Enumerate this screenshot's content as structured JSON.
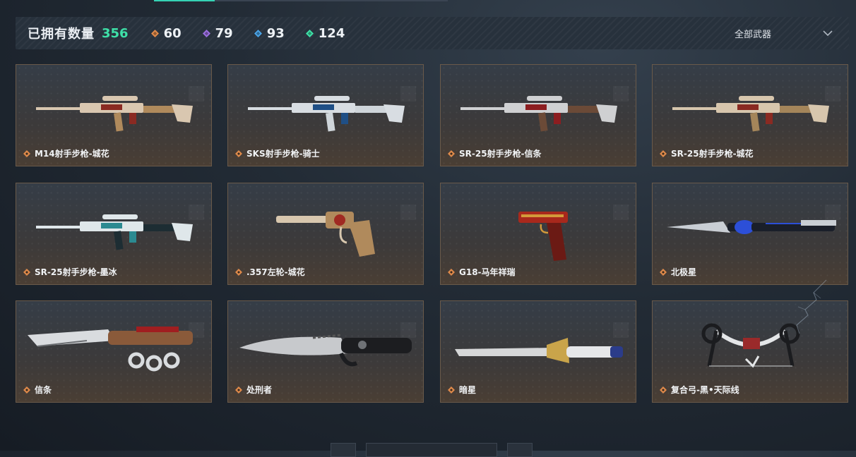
{
  "header": {
    "owned_label": "已拥有数量",
    "owned_count": "356",
    "rarities": [
      {
        "icon": "orange-diamond-icon",
        "color": "#e08a4a",
        "count": "60"
      },
      {
        "icon": "purple-diamond-icon",
        "color": "#9a6ee0",
        "count": "79"
      },
      {
        "icon": "blue-diamond-icon",
        "color": "#4aa3e6",
        "count": "93"
      },
      {
        "icon": "green-diamond-icon",
        "color": "#3ee0a8",
        "count": "124"
      }
    ],
    "filter_label": "全部武器"
  },
  "weapons": [
    {
      "name": "M14射手步枪-城花",
      "type": "rifle",
      "palette": [
        "#d9c7b0",
        "#8a2a22",
        "#b08a5c"
      ]
    },
    {
      "name": "SKS射手步枪-骑士",
      "type": "rifle",
      "palette": [
        "#d8dde2",
        "#1f4f86",
        "#cfd5da"
      ]
    },
    {
      "name": "SR-25射手步枪-信条",
      "type": "rifle",
      "palette": [
        "#cfd0d2",
        "#8c1d20",
        "#6b4a37"
      ]
    },
    {
      "name": "SR-25射手步枪-城花",
      "type": "rifle",
      "palette": [
        "#d7c6ad",
        "#8a2a22",
        "#a4855a"
      ]
    },
    {
      "name": "SR-25射手步枪-墨冰",
      "type": "rifle",
      "palette": [
        "#dfe7ea",
        "#2b8a91",
        "#1d2d33"
      ]
    },
    {
      "name": ".357左轮-城花",
      "type": "revolver",
      "palette": [
        "#d8c7ae",
        "#a02a22",
        "#b08a5c"
      ]
    },
    {
      "name": "G18-马年祥瑞",
      "type": "pistol",
      "palette": [
        "#a8281c",
        "#d39a3a",
        "#6b1a14"
      ]
    },
    {
      "name": "北极星",
      "type": "dagger",
      "palette": [
        "#c9ced4",
        "#2c4fd8",
        "#1a1f2a"
      ]
    },
    {
      "name": "信条",
      "type": "knuckle",
      "palette": [
        "#d9dcdf",
        "#8a5a3a",
        "#a01e20"
      ]
    },
    {
      "name": "处刑者",
      "type": "knife",
      "palette": [
        "#c7c9cc",
        "#1c1d20",
        "#6f7276"
      ]
    },
    {
      "name": "暗星",
      "type": "sword",
      "palette": [
        "#d6d7d8",
        "#c9a44a",
        "#2b3c8a"
      ]
    },
    {
      "name": "复合弓-黑•天际线",
      "type": "bow",
      "palette": [
        "#e4e6e8",
        "#1b1c1f",
        "#9a2a2a"
      ]
    }
  ]
}
